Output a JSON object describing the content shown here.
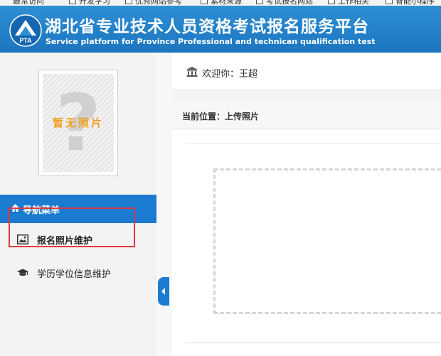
{
  "bookmarks": [
    "最常访问",
    "开发学习",
    "优秀网站参考",
    "素材来源",
    "考试报名网站",
    "工作相关",
    "智能小程序"
  ],
  "header": {
    "logo_text": "PTA",
    "title_cn": "湖北省专业技术人员资格考试报名服务平台",
    "title_en": "Service platform for Province Professional and technican qualification test"
  },
  "sidebar": {
    "photo_placeholder": "暂无照片",
    "nav_header": "导航菜单",
    "items": [
      {
        "label": "报名照片维护",
        "icon": "image-icon"
      },
      {
        "label": "学历学位信息维护",
        "icon": "graduation-cap-icon"
      }
    ]
  },
  "topbar": {
    "welcome": "欢迎你：王超",
    "icon": "bank-icon"
  },
  "breadcrumb": {
    "text": "当前位置：上传照片"
  },
  "colors": {
    "brand": "#1b7bd1",
    "highlight": "#e0383e",
    "placeholder_text": "#f0a020"
  }
}
